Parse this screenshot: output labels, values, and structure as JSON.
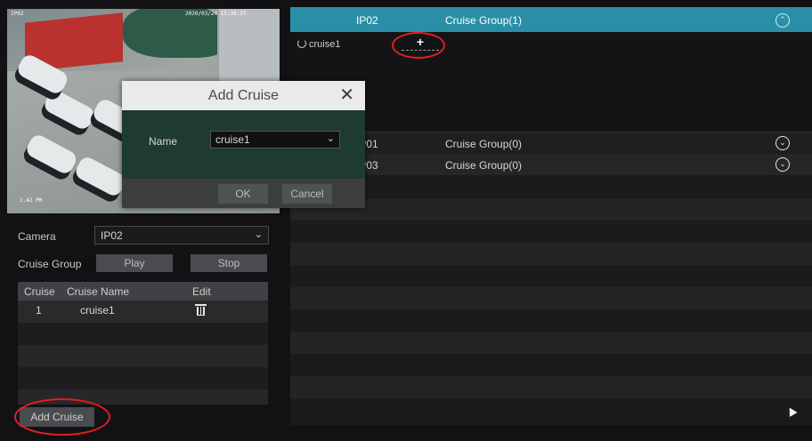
{
  "preview": {
    "camera_label": "IP02",
    "timestamp": "2020/03/24 15:38:37",
    "bottom_label": "1.42 PM"
  },
  "left": {
    "camera_label": "Camera",
    "camera_value": "IP02",
    "cruise_group_label": "Cruise Group",
    "play_label": "Play",
    "stop_label": "Stop",
    "table": {
      "headers": [
        "Cruise",
        "Cruise Name",
        "Edit"
      ],
      "rows": [
        {
          "cruise": "1",
          "name": "cruise1",
          "edit_icon": "trash-icon"
        }
      ]
    },
    "add_cruise_label": "Add Cruise"
  },
  "right": {
    "groups": [
      {
        "camera": "IP02",
        "group": "Cruise Group(1)",
        "icon": "chevron-up-circle-icon",
        "expanded": true
      },
      {
        "camera": "IP01",
        "group": "Cruise Group(0)",
        "icon": "chevron-down-circle-icon",
        "expanded": false
      },
      {
        "camera": "IP03",
        "group": "Cruise Group(0)",
        "icon": "chevron-down-circle-icon",
        "expanded": false
      }
    ],
    "cruise_item": "cruise1",
    "add_button_icon": "plus-icon"
  },
  "dialog": {
    "title": "Add Cruise",
    "name_label": "Name",
    "name_value": "cruise1",
    "ok_label": "OK",
    "cancel_label": "Cancel"
  },
  "colors": {
    "accent": "#2a8fa6",
    "dialog_body": "#1f3a30",
    "annotation": "#e41e1e"
  }
}
